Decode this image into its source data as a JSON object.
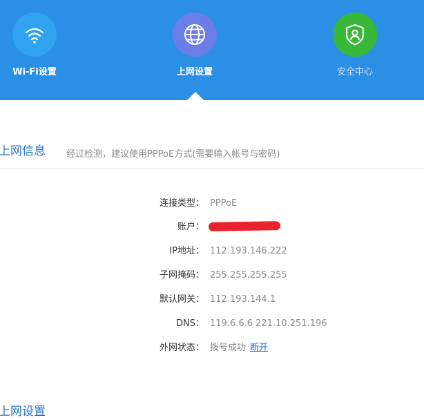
{
  "nav": {
    "items": [
      {
        "label": "Wi-Fi设置",
        "icon": "wifi-icon",
        "color": "#2fa3f0"
      },
      {
        "label": "上网设置",
        "icon": "globe-icon",
        "color": "#6b7ee8"
      },
      {
        "label": "安全中心",
        "icon": "shield-user-icon",
        "color": "#38b838"
      }
    ]
  },
  "internet_info": {
    "title": "上网信息",
    "hint": "经过检测，建议使用PPPoE方式(需要输入帐号与密码)",
    "rows": [
      {
        "label": "连接类型：",
        "value": "PPPoE"
      },
      {
        "label": "账户：",
        "value": ""
      },
      {
        "label": "IP地址：",
        "value": "112.193.146.222"
      },
      {
        "label": "子网掩码：",
        "value": "255.255.255.255"
      },
      {
        "label": "默认网关：",
        "value": "112.193.144.1"
      },
      {
        "label": "DNS：",
        "value": "119.6.6.6 221.10.251.196"
      },
      {
        "label": "外网状态：",
        "value": "拨号成功",
        "action": "断开"
      }
    ]
  },
  "internet_settings": {
    "title": "上网设置"
  },
  "colors": {
    "header_bg": "#2c8fe6",
    "accent_text": "#2474c4",
    "link": "#1e6fd0"
  }
}
